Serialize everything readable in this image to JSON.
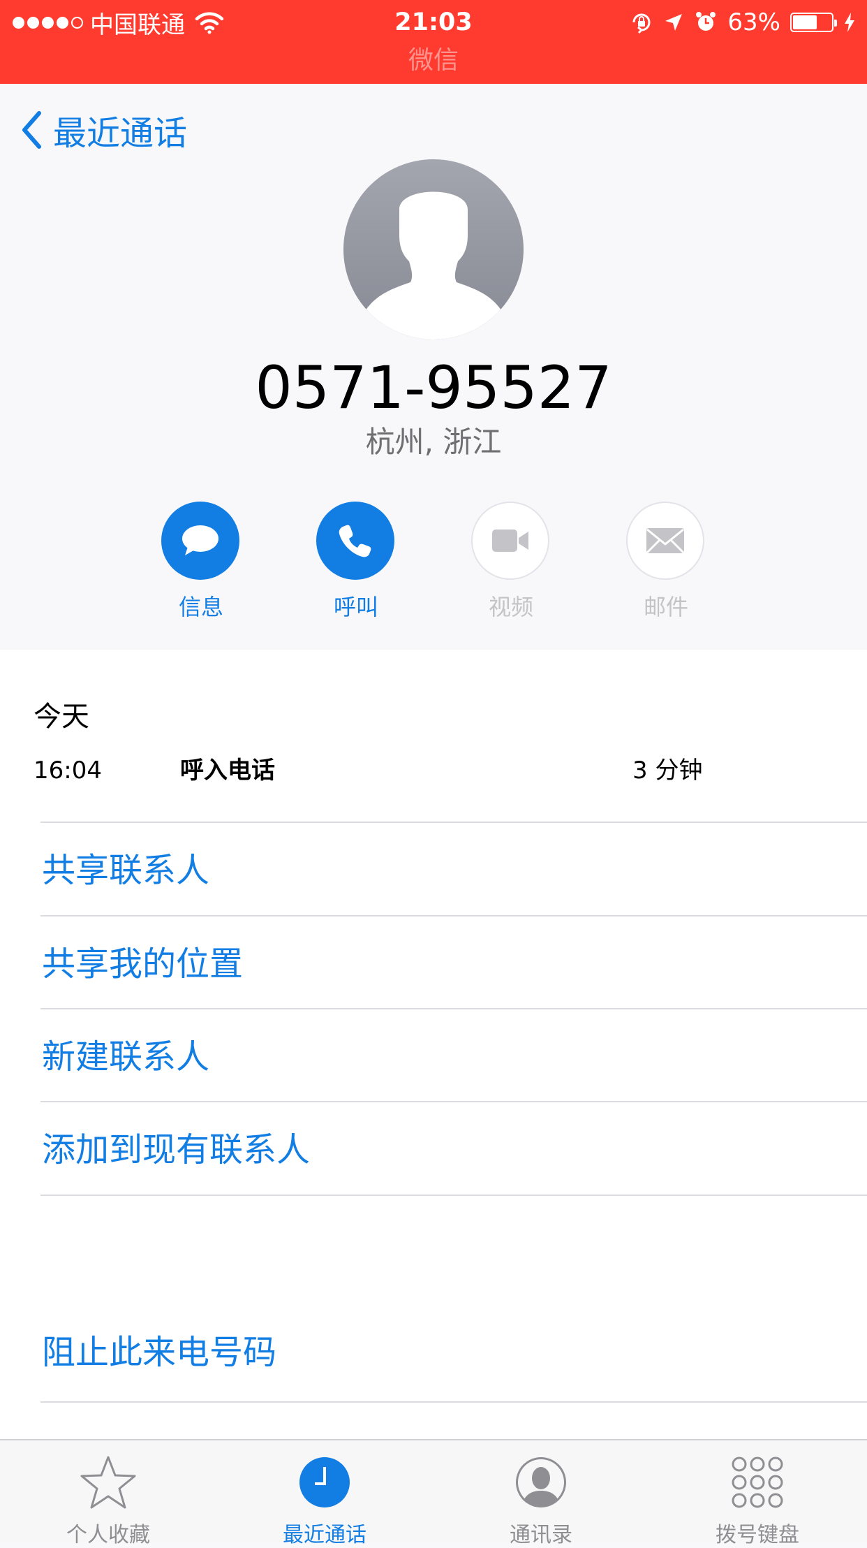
{
  "status_bar": {
    "carrier": "中国联通",
    "time": "21:03",
    "return_app": "微信",
    "battery_percent": "63%",
    "battery_level": 0.63
  },
  "nav": {
    "back_label": "最近通话"
  },
  "contact": {
    "number": "0571-95527",
    "location": "杭州, 浙江"
  },
  "actions": [
    {
      "label": "信息",
      "icon": "message-icon",
      "enabled": true
    },
    {
      "label": "呼叫",
      "icon": "phone-icon",
      "enabled": true
    },
    {
      "label": "视频",
      "icon": "video-icon",
      "enabled": false
    },
    {
      "label": "邮件",
      "icon": "mail-icon",
      "enabled": false
    }
  ],
  "history": {
    "day": "今天",
    "calls": [
      {
        "time": "16:04",
        "type": "呼入电话",
        "duration": "3 分钟"
      }
    ]
  },
  "options": [
    "共享联系人",
    "共享我的位置",
    "新建联系人",
    "添加到现有联系人"
  ],
  "block_option": "阻止此来电号码",
  "tabs": [
    {
      "label": "个人收藏",
      "icon": "star-icon",
      "active": false
    },
    {
      "label": "最近通话",
      "icon": "clock-icon",
      "active": true
    },
    {
      "label": "通讯录",
      "icon": "contacts-icon",
      "active": false
    },
    {
      "label": "拨号键盘",
      "icon": "keypad-icon",
      "active": false
    }
  ],
  "colors": {
    "accent": "#127ee3",
    "status_bar": "#ff3b30",
    "disabled": "#c3c3c8"
  }
}
